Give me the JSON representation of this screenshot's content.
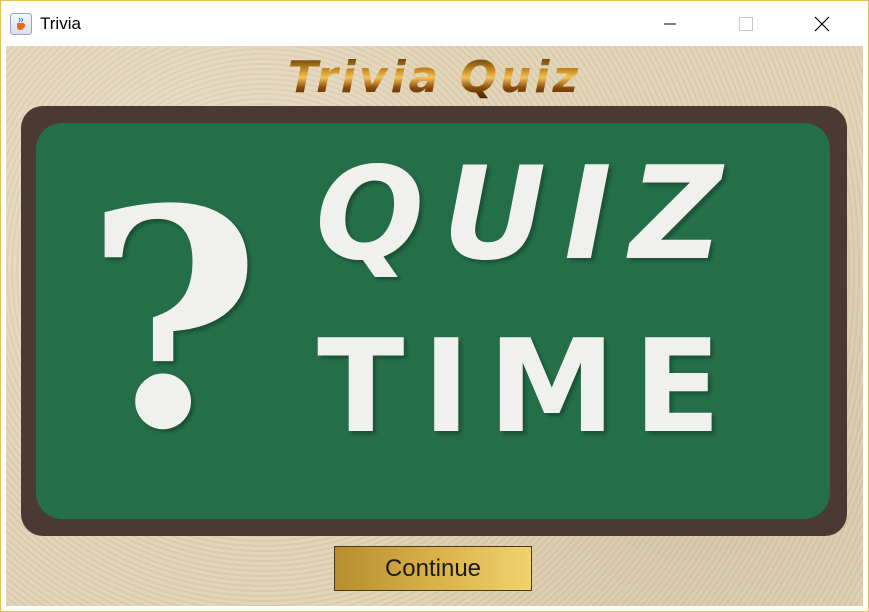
{
  "window": {
    "title": "Trivia",
    "app_icon": "java-cup-icon",
    "controls": [
      "minimize-icon",
      "maximize-icon",
      "close-icon"
    ]
  },
  "header": {
    "title": "Trivia Quiz"
  },
  "board": {
    "symbol": "?",
    "line1": "QUIZ",
    "line2": "TIME"
  },
  "actions": {
    "continue_label": "Continue"
  },
  "colors": {
    "board_green": "#246e48",
    "board_frame": "#4a3a33",
    "button_gold": "#d9b04a",
    "background": "#e2d3b6"
  }
}
